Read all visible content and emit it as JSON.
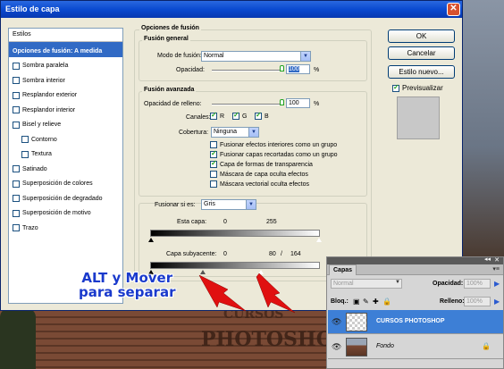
{
  "dialog": {
    "title": "Estilo de capa",
    "close_glyph": "✕"
  },
  "styles": {
    "header": "Estilos",
    "items": [
      {
        "label": "Opciones de fusión: A medida",
        "selected": true,
        "checkbox": false
      },
      {
        "label": "Sombra paralela",
        "checkbox": true
      },
      {
        "label": "Sombra interior",
        "checkbox": true
      },
      {
        "label": "Resplandor exterior",
        "checkbox": true
      },
      {
        "label": "Resplandor interior",
        "checkbox": true
      },
      {
        "label": "Bisel y relieve",
        "checkbox": true
      },
      {
        "label": "Contorno",
        "checkbox": true,
        "indent": true
      },
      {
        "label": "Textura",
        "checkbox": true,
        "indent": true
      },
      {
        "label": "Satinado",
        "checkbox": true
      },
      {
        "label": "Superposición de colores",
        "checkbox": true
      },
      {
        "label": "Superposición de degradado",
        "checkbox": true
      },
      {
        "label": "Superposición de motivo",
        "checkbox": true
      },
      {
        "label": "Trazo",
        "checkbox": true
      }
    ]
  },
  "blending": {
    "section_title": "Opciones de fusión",
    "general": {
      "title": "Fusión general",
      "mode_label": "Modo de fusión:",
      "mode_value": "Normal",
      "opacity_label": "Opacidad:",
      "opacity_value": "100",
      "percent": "%"
    },
    "advanced": {
      "title": "Fusión avanzada",
      "fill_label": "Opacidad de relleno:",
      "fill_value": "100",
      "percent": "%",
      "channels_label": "Canales:",
      "channel_r": "R",
      "channel_g": "G",
      "channel_b": "B",
      "knockout_label": "Cobertura:",
      "knockout_value": "Ninguna",
      "options": [
        {
          "label": "Fusionar efectos interiores como un grupo",
          "checked": false
        },
        {
          "label": "Fusionar capas recortadas como un grupo",
          "checked": true
        },
        {
          "label": "Capa de formas de transparencia",
          "checked": true
        },
        {
          "label": "Máscara de capa oculta efectos",
          "checked": false
        },
        {
          "label": "Máscara vectorial oculta efectos",
          "checked": false
        }
      ]
    },
    "blend_if": {
      "label": "Fusionar si es:",
      "value": "Gris",
      "this_layer_label": "Esta capa:",
      "this_layer_min": "0",
      "this_layer_max": "255",
      "underlying_label": "Capa subyacente:",
      "underlying_min": "0",
      "underlying_split": "80",
      "underlying_sep": "/",
      "underlying_max": "164"
    }
  },
  "buttons": {
    "ok": "OK",
    "cancel": "Cancelar",
    "new_style": "Estilo nuevo...",
    "preview": "Previsualizar"
  },
  "overlay": {
    "line1": "ALT y Mover",
    "line2": "para separar"
  },
  "background": {
    "stamp_top": "CURSOS",
    "stamp": "PHOTOSHOP"
  },
  "layers_panel": {
    "tab": "Capas",
    "mode": "Normal",
    "opacity_label": "Opacidad:",
    "opacity_value": "100%",
    "lock_label": "Bloq.:",
    "fill_label": "Relleno:",
    "fill_value": "100%",
    "layers": [
      {
        "name": "CURSOS PHOTOSHOP",
        "active": true
      },
      {
        "name": "Fondo",
        "active": false
      }
    ]
  }
}
